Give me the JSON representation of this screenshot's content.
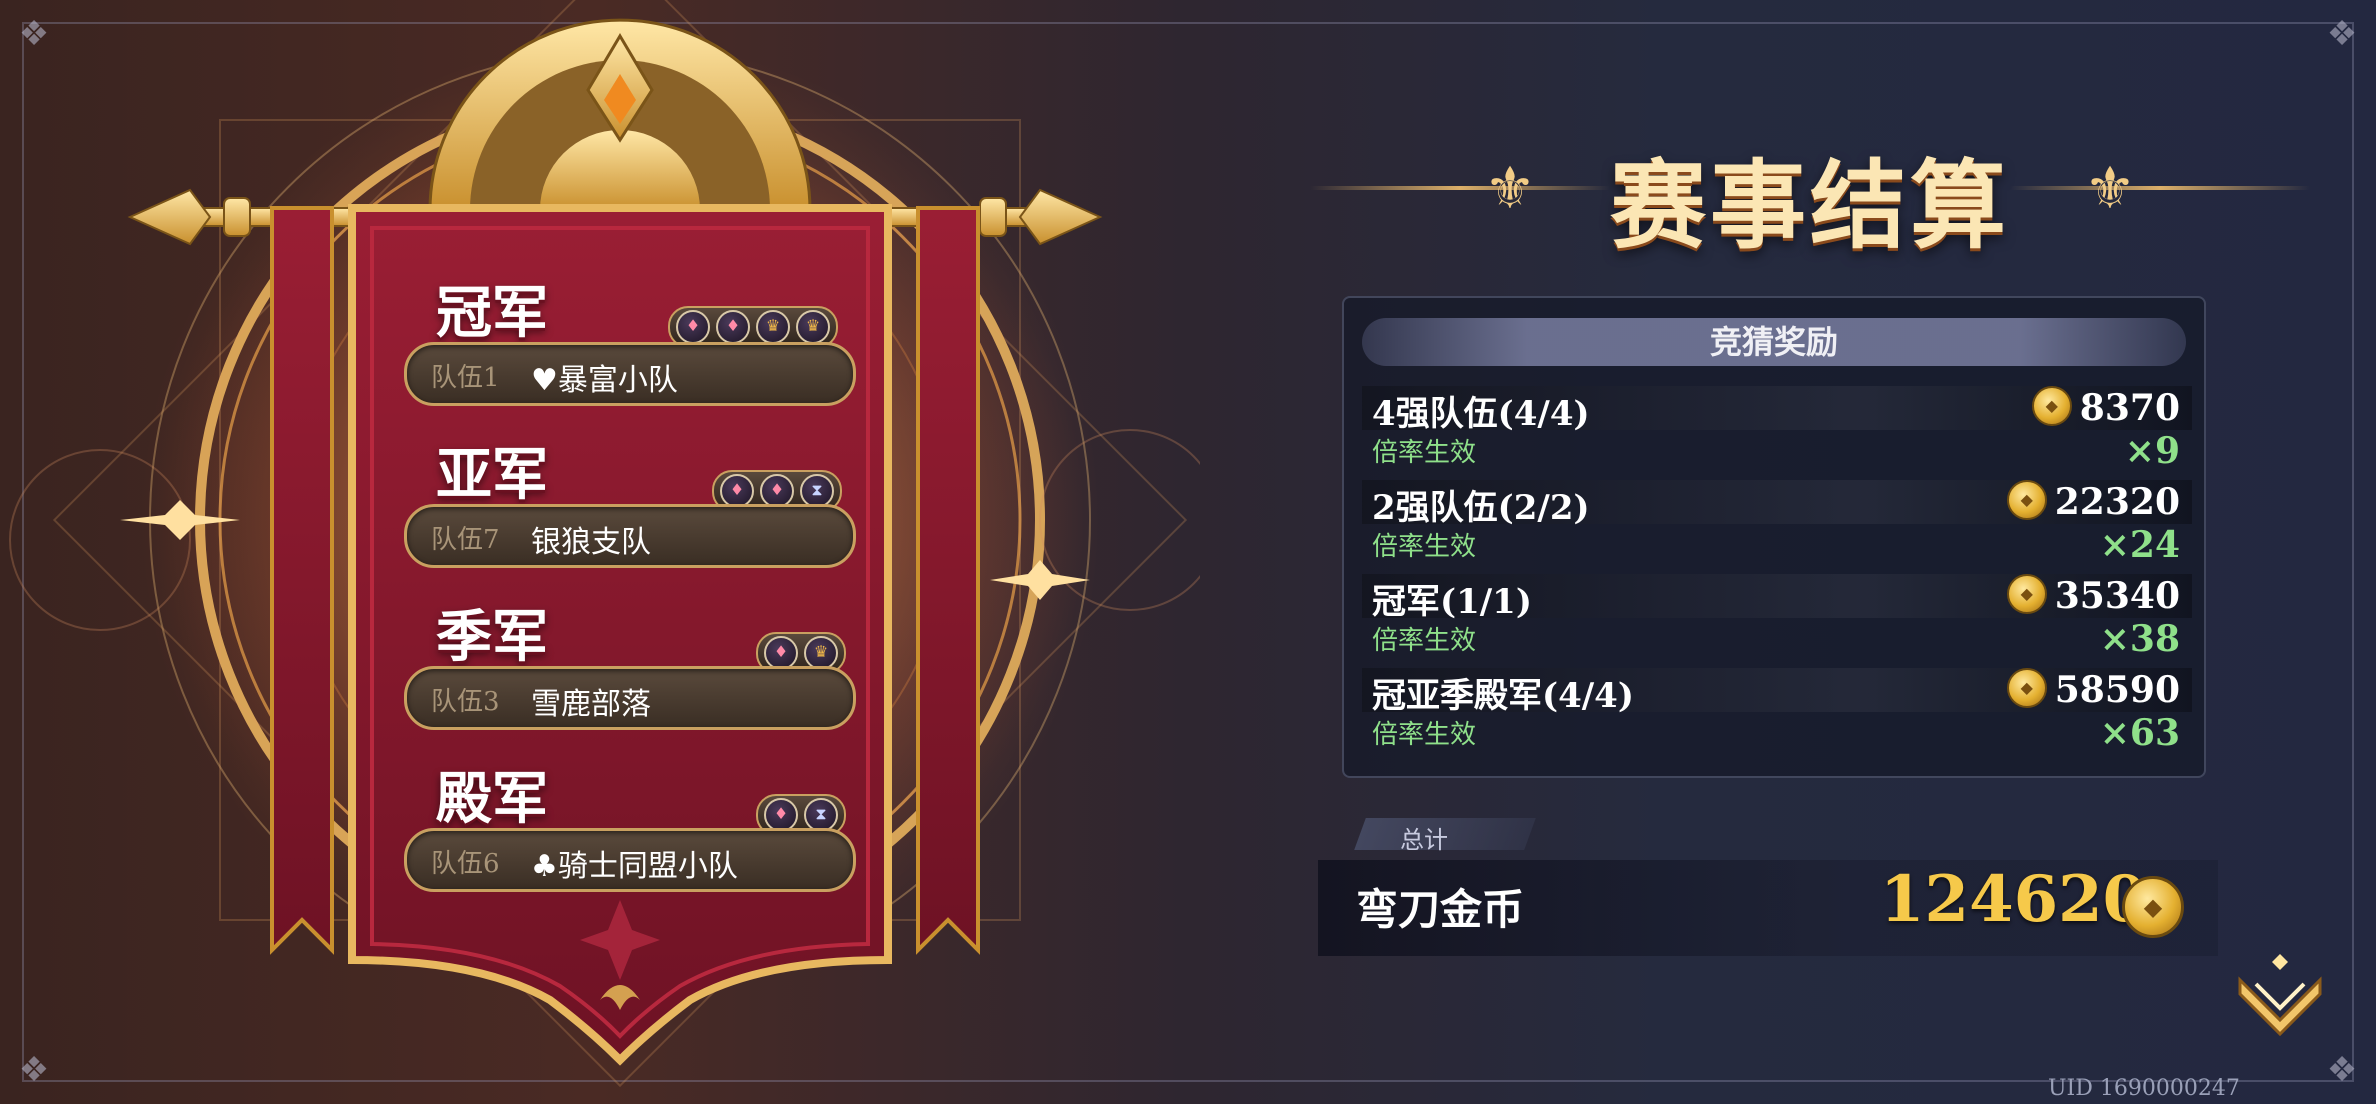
{
  "settlement": {
    "title": "赛事结算",
    "panel_title": "竞猜奖励",
    "rows": [
      {
        "label": "4强队伍(4/4)",
        "sub": "倍率生效",
        "amount": "8370",
        "multiplier": "×9"
      },
      {
        "label": "2强队伍(2/2)",
        "sub": "倍率生效",
        "amount": "22320",
        "multiplier": "×24"
      },
      {
        "label": "冠军(1/1)",
        "sub": "倍率生效",
        "amount": "35340",
        "multiplier": "×38"
      },
      {
        "label": "冠亚季殿军(4/4)",
        "sub": "倍率生效",
        "amount": "58590",
        "multiplier": "×63"
      }
    ],
    "total_tab": "总计",
    "total_label": "弯刀金币",
    "total_value": "124620"
  },
  "uid": "UID 1690000247",
  "rankings": [
    {
      "title": "冠军",
      "team_id": "队伍1",
      "team_name": "♥暴富小队",
      "badges": [
        "card-4",
        "card-2",
        "trophy",
        "trophy"
      ]
    },
    {
      "title": "亚军",
      "team_id": "队伍7",
      "team_name": "银狼支队",
      "badges": [
        "card-4",
        "card-4",
        "hourglass"
      ]
    },
    {
      "title": "季军",
      "team_id": "队伍3",
      "team_name": "雪鹿部落",
      "badges": [
        "card-4",
        "trophy"
      ]
    },
    {
      "title": "殿军",
      "team_id": "队伍6",
      "team_name": "♣骑士同盟小队",
      "badges": [
        "card-4",
        "hourglass"
      ]
    }
  ],
  "colors": {
    "gold": "#f6c94a",
    "multiplier_green": "#8fe08a",
    "banner_red": "#8a1a30",
    "banner_gold": "#e8b860"
  }
}
